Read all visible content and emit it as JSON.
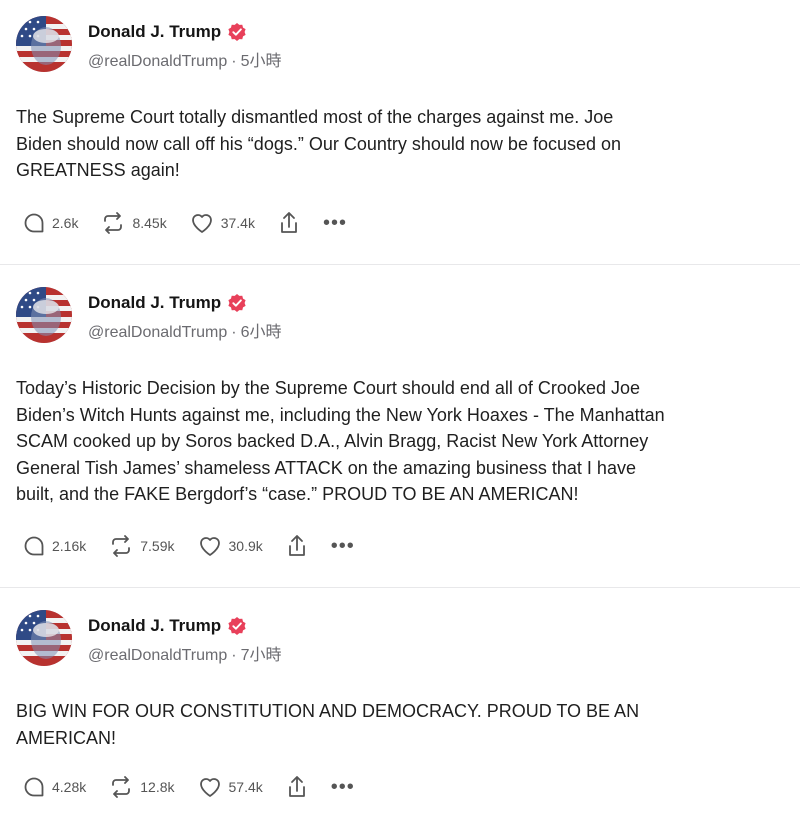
{
  "posts": [
    {
      "author": "Donald J. Trump",
      "handle": "@realDonaldTrump",
      "time": "5小時",
      "text": "The Supreme Court totally dismantled most of the charges against me. Joe\nBiden should now call off his “dogs.” Our Country should now be focused on\nGREATNESS again!",
      "replies": "2.6k",
      "reposts": "8.45k",
      "likes": "37.4k"
    },
    {
      "author": "Donald J. Trump",
      "handle": "@realDonaldTrump",
      "time": "6小時",
      "text": "Today’s Historic Decision by the Supreme Court should end all of Crooked Joe\nBiden’s Witch Hunts against me, including the New York Hoaxes - The Manhattan\nSCAM cooked up by Soros backed D.A., Alvin Bragg, Racist New York Attorney\nGeneral Tish James’ shameless ATTACK on the amazing business that I have\nbuilt, and the FAKE Bergdorf’s “case.” PROUD TO BE AN AMERICAN!",
      "replies": "2.16k",
      "reposts": "7.59k",
      "likes": "30.9k"
    },
    {
      "author": "Donald J. Trump",
      "handle": "@realDonaldTrump",
      "time": "7小時",
      "text": "BIG WIN FOR OUR CONSTITUTION AND DEMOCRACY. PROUD TO BE AN\nAMERICAN!",
      "replies": "4.28k",
      "reposts": "12.8k",
      "likes": "57.4k"
    }
  ],
  "separator": "·",
  "more_glyph": "•••",
  "icons": {
    "reply": "reply-icon",
    "repost": "repost-icon",
    "like": "heart-icon",
    "share": "share-icon",
    "more": "more-icon",
    "verified": "verified-badge-icon"
  },
  "colors": {
    "verified": "#e8405a",
    "text": "#1f1f1f",
    "muted": "#6b6b70"
  }
}
